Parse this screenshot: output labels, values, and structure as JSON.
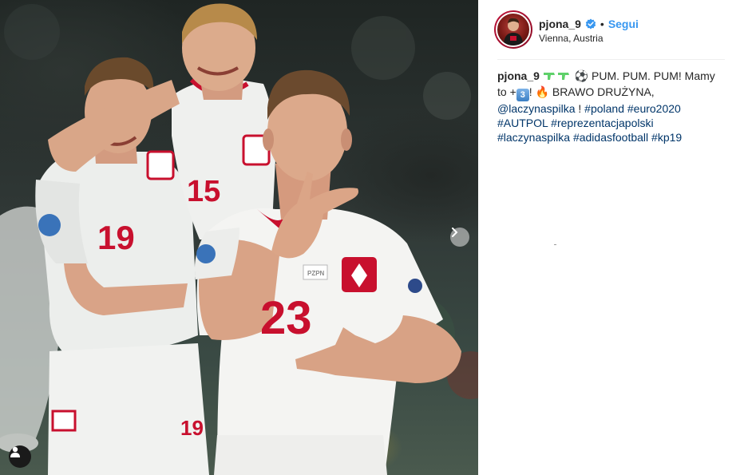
{
  "photo": {
    "alt": "",
    "jersey_numbers": {
      "left": "19",
      "left_shorts": "19",
      "middle": "15",
      "front": "23"
    },
    "chest_print": "PZPN",
    "carousel_next_icon": "chevron-right-icon",
    "tag_icon": "person-icon"
  },
  "post": {
    "username": "pjona_9",
    "verified_icon": "verified-badge-icon",
    "separator": "•",
    "follow_label": "Segui",
    "location": "Vienna, Austria",
    "caption": {
      "user": "pjona_9",
      "gun_emoji": "water-pistol-icon",
      "ball_emoji": "⚽",
      "text1": "PUM. PUM. PUM! Mamy to +",
      "keycap": "3",
      "text2": "!",
      "fire_emoji": "🔥",
      "text3": "BRAWO DRUŻYNA,",
      "mention": "@laczynaspilka",
      "text4": "!",
      "hashtags": [
        "#poland",
        "#euro2020",
        "#AUTPOL",
        "#reprezentacjapolski",
        "#laczynaspilka",
        "#adidasfootball",
        "#kp19"
      ]
    }
  },
  "colors": {
    "link": "#003569",
    "follow": "#3897f0",
    "text": "#262626",
    "jersey_red": "#c8102e"
  }
}
